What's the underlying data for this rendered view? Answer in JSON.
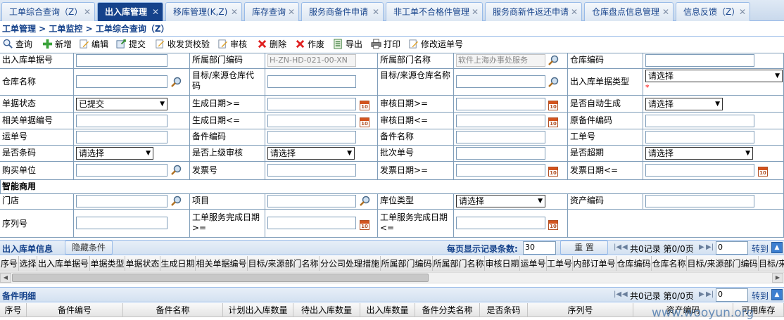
{
  "tabs": [
    {
      "label": "工单综合查询（Z）",
      "active": false
    },
    {
      "label": "出入库管理",
      "active": true
    },
    {
      "label": "移库管理(K,Z)",
      "active": false
    },
    {
      "label": "库存查询",
      "active": false
    },
    {
      "label": "服务商备件申请",
      "active": false
    },
    {
      "label": "非工单不合格件管理",
      "active": false
    },
    {
      "label": "服务商新件返还申请",
      "active": false
    },
    {
      "label": "仓库盘点信息管理",
      "active": false
    },
    {
      "label": "信息反馈（Z）",
      "active": false
    }
  ],
  "breadcrumb": "工单管理 > 工单监控 > 工单综合查询（Z）",
  "toolbar": [
    "查询",
    "新增",
    "编辑",
    "提交",
    "收发货校验",
    "审核",
    "删除",
    "作废",
    "导出",
    "打印",
    "修改运单号"
  ],
  "form": {
    "r1": {
      "a": "出入库单据号",
      "b": "所属部门编码",
      "b_val": "H-ZN-HD-021-00-XN",
      "c": "所属部门名称",
      "c_val": "软件上海办事处服务",
      "d": "仓库编码"
    },
    "r2": {
      "a": "仓库名称",
      "b": "目标/来源仓库代码",
      "c": "目标/来源仓库名称",
      "d": "出入库单据类型",
      "d_val": "请选择"
    },
    "r3": {
      "a": "单据状态",
      "a_val": "已提交",
      "b": "生成日期>=",
      "c": "审核日期>=",
      "d": "是否自动生成",
      "d_val": "请选择"
    },
    "r4": {
      "a": "相关单据编号",
      "b": "生成日期<=",
      "c": "审核日期<=",
      "d": "原备件编码"
    },
    "r5": {
      "a": "运单号",
      "b": "备件编码",
      "c": "备件名称",
      "d": "工单号"
    },
    "r6": {
      "a": "是否条码",
      "a_val": "请选择",
      "b": "是否上级审核",
      "b_val": "请选择",
      "c": "批次单号",
      "d": "是否超期",
      "d_val": "请选择"
    },
    "r7": {
      "a": "购买单位",
      "b": "发票号",
      "c": "发票日期>=",
      "d": "发票日期<="
    },
    "section_smart": "智能商用",
    "r8": {
      "a": "门店",
      "b": "项目",
      "c": "库位类型",
      "c_val": "请选择",
      "d": "资产编码"
    },
    "r9": {
      "a": "序列号",
      "b": "工单服务完成日期>=",
      "c": "工单服务完成日期<="
    }
  },
  "required_mark": "*",
  "inout": {
    "title": "出入库单信息",
    "hide_btn": "隐藏条件",
    "per_page_label": "每页显示记录条数:",
    "per_page_value": "30",
    "reset_btn": "重 置",
    "nav_text": "共0记录 第0/0页",
    "page_input": "0",
    "goto": "转到",
    "columns": [
      "序号",
      "选择",
      "出入库单据号",
      "单据类型",
      "单据状态",
      "生成日期",
      "相关单据编号",
      "目标/来源部门名称",
      "分公司处理措施",
      "所属部门编码",
      "所属部门名称",
      "审核日期",
      "运单号",
      "工单号",
      "内部订单号",
      "仓库编码",
      "仓库名称",
      "目标/来源部门编码",
      "目标/来"
    ]
  },
  "parts": {
    "title": "备件明细",
    "nav_text": "共0记录 第0/0页",
    "page_input": "0",
    "goto": "转到",
    "columns": [
      "序号",
      "备件编号",
      "备件名称",
      "计划出入库数量",
      "待出入库数量",
      "出入库数量",
      "备件分类名称",
      "是否条码",
      "序列号",
      "资产编码",
      "可用库存"
    ]
  },
  "watermark": "www.wooyun.org",
  "colors": {
    "accent": "#15428b",
    "border": "#99bbe8",
    "required": "#ff0000"
  }
}
